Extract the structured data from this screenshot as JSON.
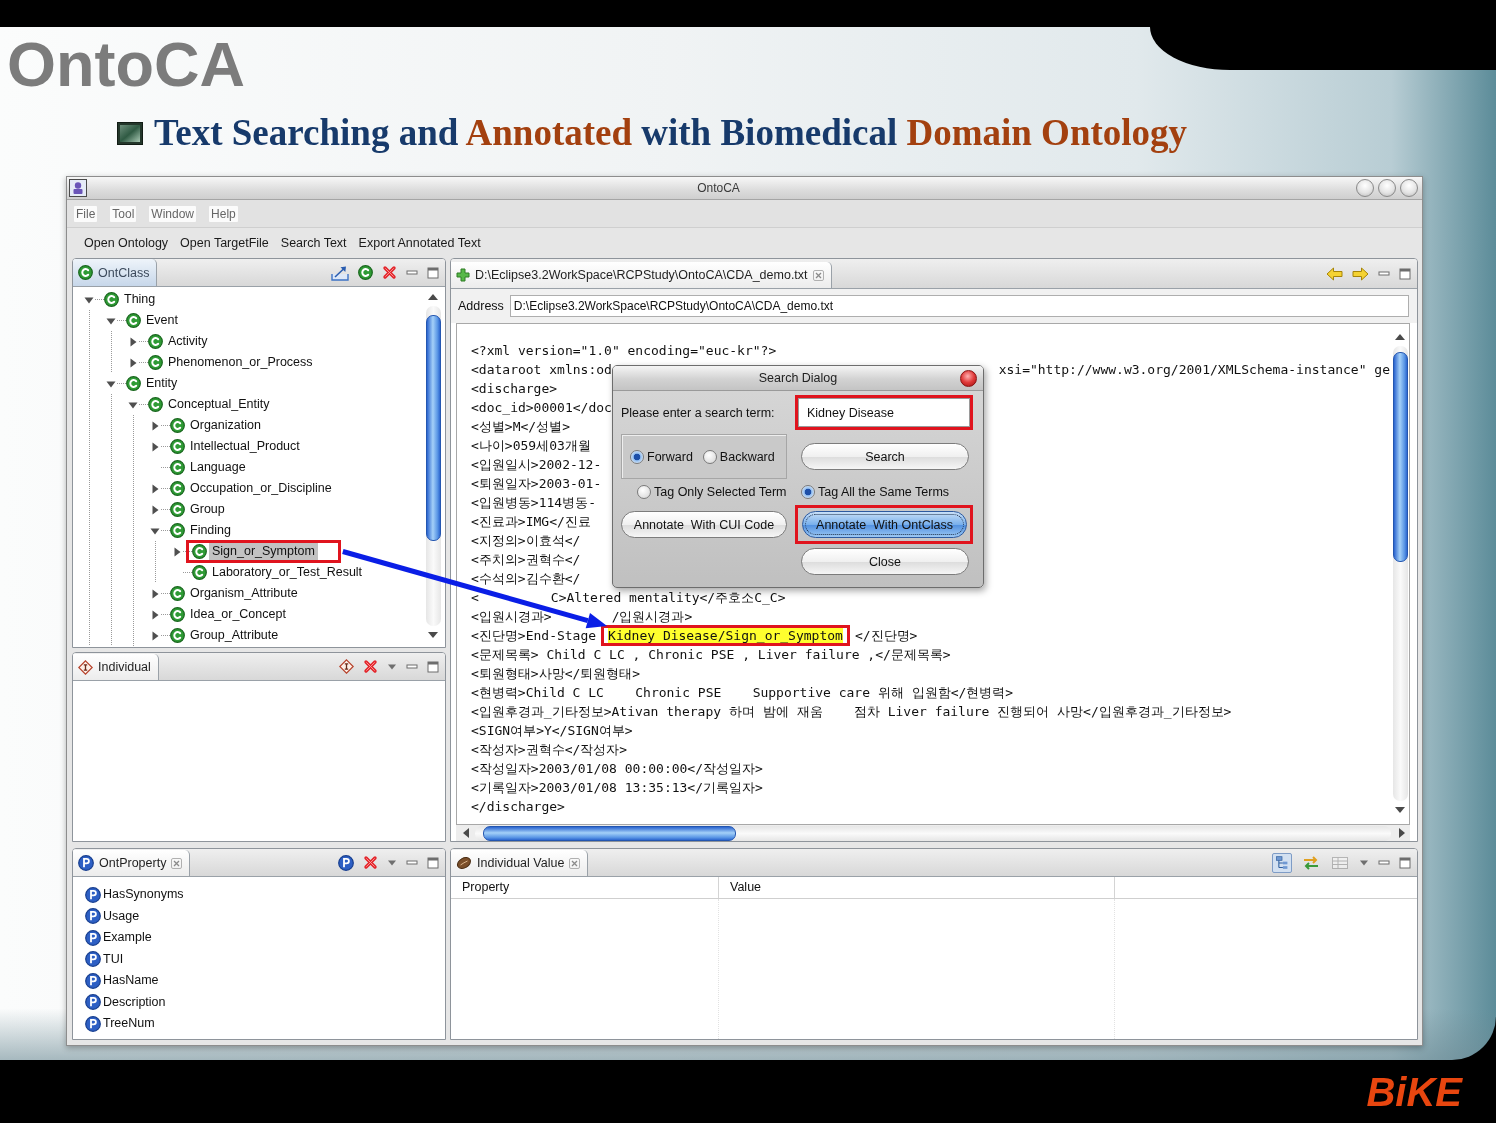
{
  "slide": {
    "title": "OntoCA",
    "subtitle": [
      {
        "text": "Text Searching and",
        "accent": false
      },
      {
        "text": "Annotated",
        "accent": true
      },
      {
        "text": "with Biomedical",
        "accent": false
      },
      {
        "text": "Domain Ontology",
        "accent": true
      }
    ],
    "logo": "BiKE"
  },
  "window": {
    "title": "OntoCA",
    "menu": [
      "File",
      "Tool",
      "Window",
      "Help"
    ],
    "toolbar": [
      "Open Ontology",
      "Open TargetFile",
      "Search Text",
      "Export Annotated Text"
    ]
  },
  "ontclass_view": {
    "tab": {
      "label": "OntClass",
      "active": true,
      "closable": false
    },
    "tools": [
      {
        "kind": "edit"
      },
      {
        "kind": "class"
      },
      {
        "kind": "delete"
      }
    ],
    "tree": [
      {
        "label": "Thing",
        "expanded": true,
        "selected": false,
        "marked": false,
        "children": [
          {
            "label": "Event",
            "expanded": true,
            "selected": false,
            "marked": false,
            "children": [
              {
                "label": "Activity",
                "expanded": false,
                "selected": false,
                "marked": false
              },
              {
                "label": "Phenomenon_or_Process",
                "expanded": false,
                "selected": false,
                "marked": false
              }
            ]
          },
          {
            "label": "Entity",
            "expanded": true,
            "selected": false,
            "marked": false,
            "children": [
              {
                "label": "Conceptual_Entity",
                "expanded": true,
                "selected": false,
                "marked": false,
                "children": [
                  {
                    "label": "Organization",
                    "expanded": false,
                    "selected": false,
                    "marked": false
                  },
                  {
                    "label": "Intellectual_Product",
                    "expanded": false,
                    "selected": false,
                    "marked": false
                  },
                  {
                    "label": "Language",
                    "selected": false,
                    "marked": false
                  },
                  {
                    "label": "Occupation_or_Discipline",
                    "expanded": false,
                    "selected": false,
                    "marked": false
                  },
                  {
                    "label": "Group",
                    "expanded": false,
                    "selected": false,
                    "marked": false
                  },
                  {
                    "label": "Finding",
                    "expanded": true,
                    "selected": false,
                    "marked": false,
                    "children": [
                      {
                        "label": "Sign_or_Symptom",
                        "expanded": false,
                        "selected": true,
                        "marked": true
                      },
                      {
                        "label": "Laboratory_or_Test_Result",
                        "selected": false,
                        "marked": false
                      }
                    ]
                  },
                  {
                    "label": "Organism_Attribute",
                    "expanded": false,
                    "selected": false,
                    "marked": false
                  },
                  {
                    "label": "Idea_or_Concept",
                    "expanded": false,
                    "selected": false,
                    "marked": false
                  },
                  {
                    "label": "Group_Attribute",
                    "expanded": false,
                    "selected": false,
                    "marked": false
                  }
                ]
              }
            ]
          }
        ]
      }
    ]
  },
  "individual_view": {
    "tab": {
      "label": "Individual",
      "active": false,
      "closable": false
    },
    "tools": [
      {
        "kind": "individual"
      },
      {
        "kind": "delete"
      },
      {
        "kind": "menu"
      }
    ]
  },
  "ontproperty_view": {
    "tab": {
      "label": "OntProperty",
      "active": false,
      "closable": true
    },
    "tools": [
      {
        "kind": "property"
      },
      {
        "kind": "delete"
      },
      {
        "kind": "menu"
      }
    ],
    "items": [
      "HasSynonyms",
      "Usage",
      "Example",
      "TUI",
      "HasName",
      "Description",
      "TreeNum"
    ]
  },
  "editor": {
    "tab": {
      "label": "D:\\Eclipse3.2WorkSpace\\RCPStudy\\OntoCA\\CDA_demo.txt",
      "active": false,
      "closable": true
    },
    "tools": [
      {
        "kind": "back"
      },
      {
        "kind": "forward"
      }
    ],
    "address_label": "Address",
    "address": "D:\\Eclipse3.2WorkSpace\\RCPStudy\\OntoCA\\CDA_demo.txt",
    "lines": [
      {
        "text": "<?xml version=\"1.0\" encoding=\"euc-kr\"?>"
      },
      {
        "text": "<dataroot xmlns:od",
        "after_dialog": "xsi=\"http://www.w3.org/2001/XMLSchema-instance\" ge"
      },
      {
        "text": "<discharge>"
      },
      {
        "text": "<doc_id>00001</doc"
      },
      {
        "text": "<성별>M</성별>"
      },
      {
        "text": "<나이>059세03개월"
      },
      {
        "text": "<입원일시>2002-12-"
      },
      {
        "text": "<퇴원일자>2003-01-"
      },
      {
        "text": "<입원병동>114병동-"
      },
      {
        "text": "<진료과>IMG</진료"
      },
      {
        "text": "<지정의>이효석</"
      },
      {
        "text": "<주치의>권혁수</"
      },
      {
        "text": "<수석의>김수환</"
      },
      {
        "segments": [
          {
            "text": "<",
            "highlighted": false,
            "marked": false,
            "after_arrow": false
          },
          {
            "text": "C>Altered mentality</주호소C_C>",
            "highlighted": false,
            "marked": false,
            "after_arrow": true
          }
        ]
      },
      {
        "segments": [
          {
            "text": "<입원시경과>",
            "highlighted": false,
            "marked": false,
            "after_arrow": false
          },
          {
            "text": "/입원시경과>",
            "highlighted": false,
            "marked": false,
            "after_arrow": true
          }
        ]
      },
      {
        "segments": [
          {
            "text": "<진단명>End-Stage",
            "highlighted": false,
            "marked": false,
            "after_arrow": false
          },
          {
            "text": "Kidney Disease/Sign_or_Symptom",
            "highlighted": true,
            "marked": true,
            "after_arrow": false
          },
          {
            "text": "</진단명>",
            "highlighted": false,
            "marked": false,
            "after_arrow": false
          }
        ]
      },
      {
        "text": "<문제목록> Child C LC , Chronic PSE , Liver failure ,</문제목록>"
      },
      {
        "text": "<퇴원형태>사망</퇴원형태>"
      },
      {
        "text": "<현병력>Child C LC    Chronic PSE    Supportive care 위해 입원함</현병력>"
      },
      {
        "text": "<입원후경과_기타정보>Ativan therapy 하며 밤에 재움    점차 Liver failure 진행되어 사망</입원후경과_기타정보>"
      },
      {
        "text": "<SIGN여부>Y</SIGN여부>"
      },
      {
        "text": "<작성자>권혁수</작성자>"
      },
      {
        "text": "<작성일자>2003/01/08 00:00:00</작성일자>"
      },
      {
        "text": "<기록일자>2003/01/08 13:35:13</기록일자>"
      },
      {
        "text": "</discharge>"
      }
    ]
  },
  "search_dialog": {
    "title": "Search Dialog",
    "prompt": "Please enter a search term:",
    "search_field": {
      "value": "Kidney Disease",
      "marked": true
    },
    "direction_options": [
      {
        "label": "Forward",
        "selected": true
      },
      {
        "label": "Backward",
        "selected": false
      }
    ],
    "search_button": {
      "label": "Search",
      "focused": false,
      "marked": false
    },
    "tag_options": [
      {
        "label": "Tag Only Selected Term",
        "selected": false
      },
      {
        "label": "Tag All the Same Terms",
        "selected": true
      }
    ],
    "annotate_buttons": [
      {
        "label": "Annotate  With CUI Code",
        "focused": false,
        "marked": false
      },
      {
        "label": "Annotate  With OntClass",
        "focused": true,
        "marked": true
      }
    ],
    "close_button": {
      "label": "Close",
      "focused": false,
      "marked": false
    }
  },
  "individual_value_view": {
    "tab": {
      "label": "Individual Value",
      "active": false,
      "closable": true
    },
    "tools": [
      {
        "kind": "tree",
        "pressed": true,
        "disabled": false
      },
      {
        "kind": "swap",
        "pressed": false,
        "disabled": false
      },
      {
        "kind": "grid",
        "pressed": false,
        "disabled": true
      },
      {
        "kind": "menu",
        "pressed": false,
        "disabled": false
      }
    ],
    "columns": [
      "Property",
      "Value"
    ]
  }
}
